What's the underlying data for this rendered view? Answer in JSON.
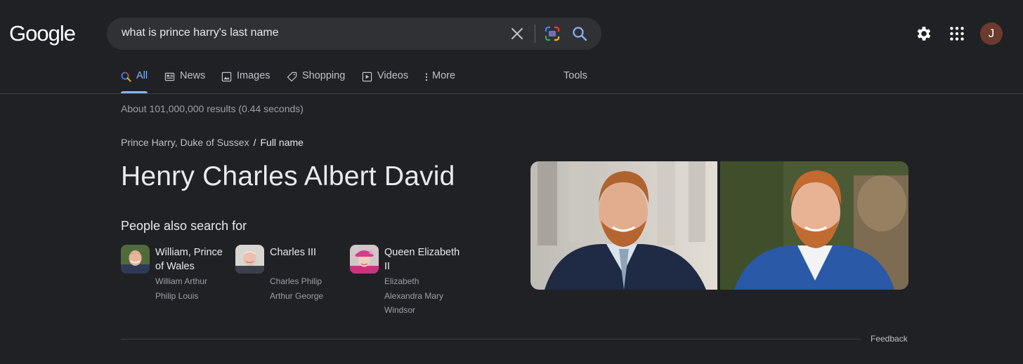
{
  "header": {
    "logo_text": "Google",
    "search": {
      "query": "what is prince harry's last name"
    },
    "avatar_initial": "J"
  },
  "tabs": [
    {
      "label": "All",
      "icon": "search-icon",
      "active": true
    },
    {
      "label": "News",
      "icon": "news-icon",
      "active": false
    },
    {
      "label": "Images",
      "icon": "image-icon",
      "active": false
    },
    {
      "label": "Shopping",
      "icon": "tag-icon",
      "active": false
    },
    {
      "label": "Videos",
      "icon": "play-icon",
      "active": false
    },
    {
      "label": "More",
      "icon": "more-vert-icon",
      "active": false
    },
    {
      "label": "Tools",
      "icon": "",
      "active": false
    }
  ],
  "results_stats": "About 101,000,000 results (0.44 seconds)",
  "breadcrumb": {
    "parent": "Prince Harry, Duke of Sussex",
    "separator": "/",
    "current": "Full name"
  },
  "answer": "Henry Charles Albert David",
  "people_also_search": {
    "title": "People also search for",
    "items": [
      {
        "name": "William, Prince of Wales",
        "subtitle": "William Arthur Philip Louis"
      },
      {
        "name": "Charles III",
        "subtitle": "Charles Philip Arthur George"
      },
      {
        "name": "Queen Elizabeth II",
        "subtitle": "Elizabeth Alexandra Mary Windsor"
      }
    ]
  },
  "feedback_label": "Feedback",
  "colors": {
    "background": "#202124",
    "accent": "#8ab4f8",
    "search_box": "#303134",
    "text_primary": "#e8eaed",
    "text_secondary": "#9aa0a6"
  }
}
